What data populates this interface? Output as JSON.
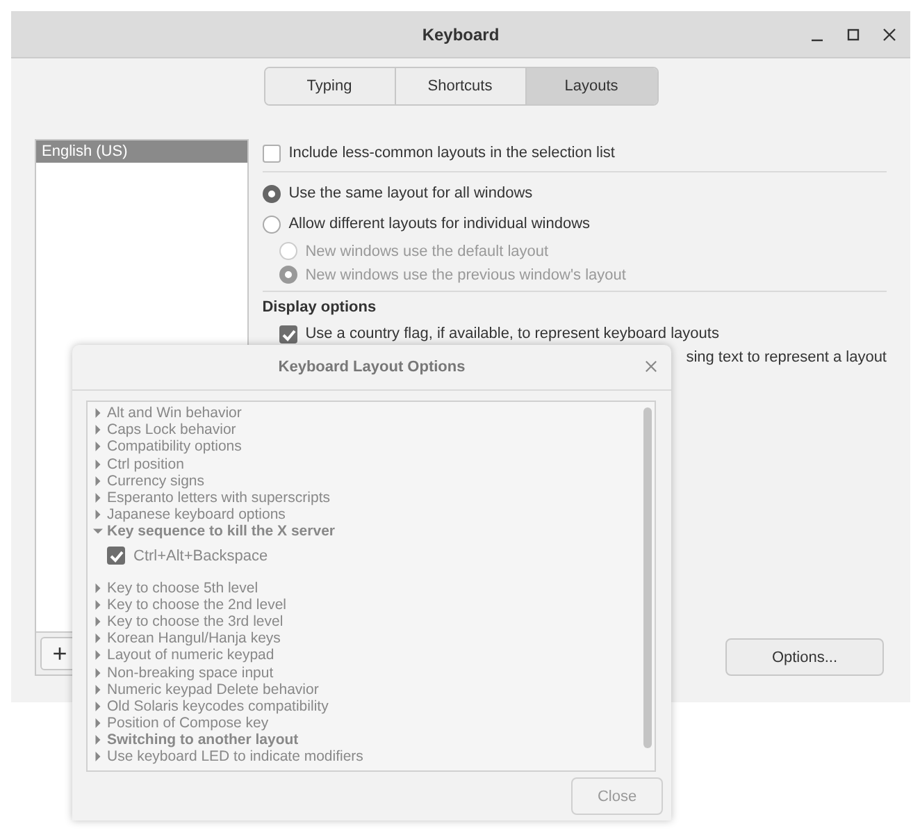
{
  "main_window": {
    "title": "Keyboard",
    "tabs": [
      {
        "label": "Typing",
        "selected": false
      },
      {
        "label": "Shortcuts",
        "selected": false
      },
      {
        "label": "Layouts",
        "selected": true
      }
    ],
    "layouts_list": {
      "items": [
        {
          "label": "English (US)",
          "selected": true
        }
      ],
      "add_button": "+"
    },
    "include_less_common": {
      "label": "Include less-common layouts in the selection list",
      "checked": false
    },
    "window_modes": [
      {
        "label": "Use the same layout for all windows",
        "selected": true
      },
      {
        "label": "Allow different layouts for individual windows",
        "selected": false,
        "children": [
          {
            "label": "New windows use the default layout",
            "selected": false,
            "disabled": true
          },
          {
            "label": "New windows use the previous window's layout",
            "selected": true,
            "disabled": true
          }
        ]
      }
    ],
    "display_options": {
      "heading": "Display options",
      "options": [
        {
          "label": "Use a country flag, if available,  to represent keyboard layouts",
          "checked": true
        }
      ],
      "partial_text": "sing text to represent a layout"
    },
    "options_button": "Options..."
  },
  "dialog": {
    "title": "Keyboard Layout Options",
    "tree": [
      {
        "label": "Alt and Win behavior",
        "bold": false,
        "expanded": false
      },
      {
        "label": "Caps Lock behavior",
        "bold": false,
        "expanded": false
      },
      {
        "label": "Compatibility options",
        "bold": false,
        "expanded": false
      },
      {
        "label": "Ctrl position",
        "bold": false,
        "expanded": false
      },
      {
        "label": "Currency signs",
        "bold": false,
        "expanded": false
      },
      {
        "label": "Esperanto letters with superscripts",
        "bold": false,
        "expanded": false
      },
      {
        "label": "Japanese keyboard options",
        "bold": false,
        "expanded": false
      },
      {
        "label": "Key sequence to kill the X server",
        "bold": true,
        "expanded": true,
        "children": [
          {
            "label": "Ctrl+Alt+Backspace",
            "checked": true
          }
        ]
      },
      {
        "label": "Key to choose 5th level",
        "bold": false,
        "expanded": false
      },
      {
        "label": "Key to choose the 2nd level",
        "bold": false,
        "expanded": false
      },
      {
        "label": "Key to choose the 3rd level",
        "bold": false,
        "expanded": false
      },
      {
        "label": "Korean Hangul/Hanja keys",
        "bold": false,
        "expanded": false
      },
      {
        "label": "Layout of numeric keypad",
        "bold": false,
        "expanded": false
      },
      {
        "label": "Non-breaking space input",
        "bold": false,
        "expanded": false
      },
      {
        "label": "Numeric keypad Delete behavior",
        "bold": false,
        "expanded": false
      },
      {
        "label": "Old Solaris keycodes compatibility",
        "bold": false,
        "expanded": false
      },
      {
        "label": "Position of Compose key",
        "bold": false,
        "expanded": false
      },
      {
        "label": "Switching to another layout",
        "bold": true,
        "expanded": false
      },
      {
        "label": "Use keyboard LED to indicate modifiers",
        "bold": false,
        "expanded": false
      }
    ],
    "close_button": "Close"
  }
}
